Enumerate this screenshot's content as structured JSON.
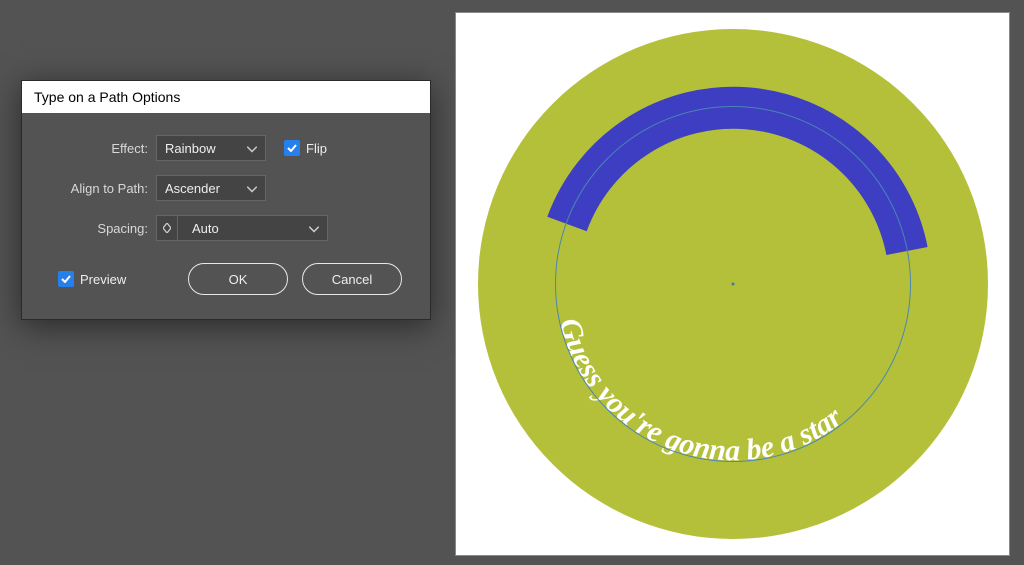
{
  "dialog": {
    "title": "Type on a Path Options",
    "effect_label": "Effect:",
    "effect_value": "Rainbow",
    "flip_label": "Flip",
    "flip_checked": true,
    "align_label": "Align to Path:",
    "align_value": "Ascender",
    "spacing_label": "Spacing:",
    "spacing_value": "Auto",
    "preview_label": "Preview",
    "preview_checked": true,
    "ok_label": "OK",
    "cancel_label": "Cancel"
  },
  "artwork": {
    "path_text": "Guess you're gonna be a star",
    "colors": {
      "circle": "#b5c03a",
      "text_bg": "#3d3ec2",
      "text_fill": "#ffffff",
      "path_stroke": "#4a86b2"
    }
  }
}
